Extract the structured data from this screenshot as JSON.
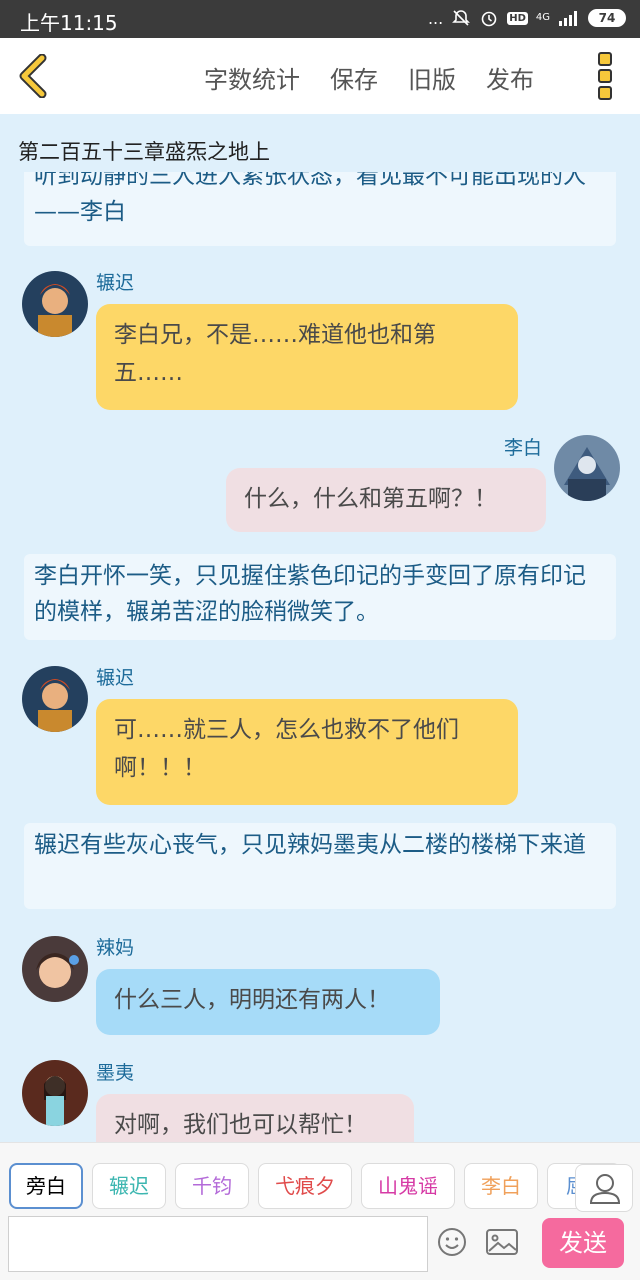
{
  "status_bar": {
    "time": "上午11:15",
    "dots": "...",
    "hd": "HD",
    "network": "4G",
    "battery": "74"
  },
  "toolbar": {
    "back_icon": "chevron-left-icon",
    "actions": [
      "字数统计",
      "保存",
      "旧版",
      "发布"
    ],
    "more_icon": "more-vertical-icon",
    "accent_color": "#f6c83b"
  },
  "chapter": {
    "title": "第二百五十三章盛炁之地上"
  },
  "messages": {
    "narration_0": "听到动静的三人进入紧张状态，看见最不可能出现的人——李白",
    "m1": {
      "speaker": "辗迟",
      "text": "李白兄，不是……难道他也和第五……"
    },
    "m2": {
      "speaker": "李白",
      "text": "什么，什么和第五啊？！"
    },
    "narration_1": "李白开怀一笑，只见握住紫色印记的手变回了原有印记的模样，辗弟苦涩的脸稍微笑了。",
    "m3": {
      "speaker": "辗迟",
      "text": "可……就三人，怎么也救不了他们啊！！！"
    },
    "narration_2": "辗迟有些灰心丧气，只见辣妈墨夷从二楼的楼梯下来道",
    "m4": {
      "speaker": "辣妈",
      "text": "什么三人，明明还有两人！"
    },
    "m5": {
      "speaker": "墨夷",
      "text": "对啊，我们也可以帮忙！"
    }
  },
  "role_bar": {
    "roles": [
      {
        "label": "旁白",
        "color": "#666666"
      },
      {
        "label": "辗迟",
        "color": "#3cb6b0"
      },
      {
        "label": "千钧",
        "color": "#b36ad8"
      },
      {
        "label": "弋痕夕",
        "color": "#e04b4b"
      },
      {
        "label": "山鬼谣",
        "color": "#d63aa5"
      },
      {
        "label": "李白",
        "color": "#f0a05a"
      },
      {
        "label": "屈",
        "color": "#5b8fd0"
      }
    ],
    "person_icon": "person-icon"
  },
  "input_bar": {
    "placeholder": "",
    "emoji_icon": "smiley-icon",
    "image_icon": "image-icon",
    "send_label": "发送",
    "send_color": "#f56a9e"
  }
}
